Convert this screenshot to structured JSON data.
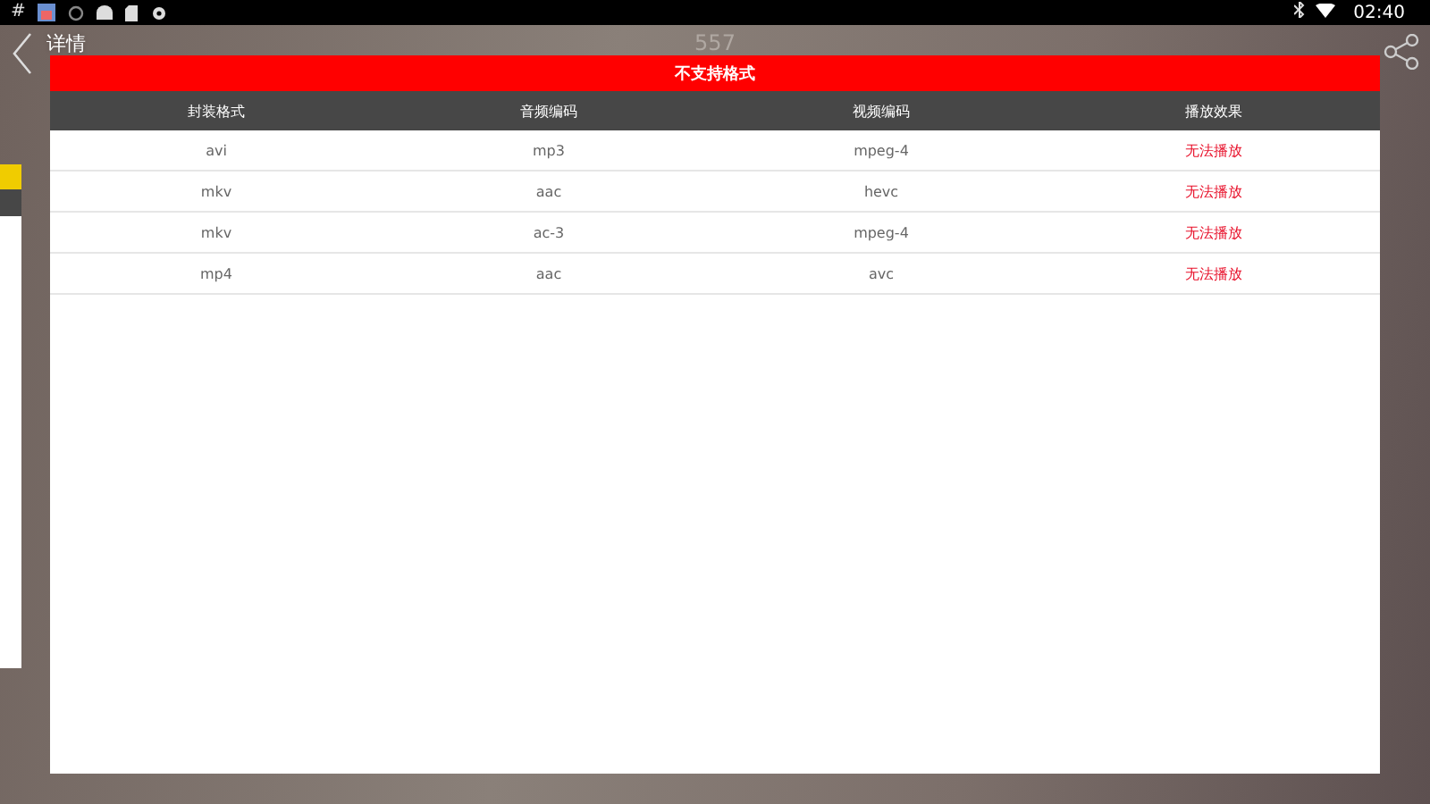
{
  "status_bar": {
    "time": "02:40",
    "left_glyph": "#"
  },
  "header": {
    "title": "详情",
    "subtitle": "557"
  },
  "dialog": {
    "title": "不支持格式",
    "table": {
      "columns": [
        {
          "kind": "text",
          "label": "封装格式"
        },
        {
          "kind": "text",
          "label": "音频编码"
        },
        {
          "kind": "text",
          "label": "视频编码"
        },
        {
          "kind": "alert",
          "label": "播放效果"
        }
      ],
      "rows": [
        [
          "avi",
          "mp3",
          "mpeg-4",
          "无法播放"
        ],
        [
          "mkv",
          "aac",
          "hevc",
          "无法播放"
        ],
        [
          "mkv",
          "ac-3",
          "mpeg-4",
          "无法播放"
        ],
        [
          "mp4",
          "aac",
          "avc",
          "无法播放"
        ]
      ]
    }
  }
}
